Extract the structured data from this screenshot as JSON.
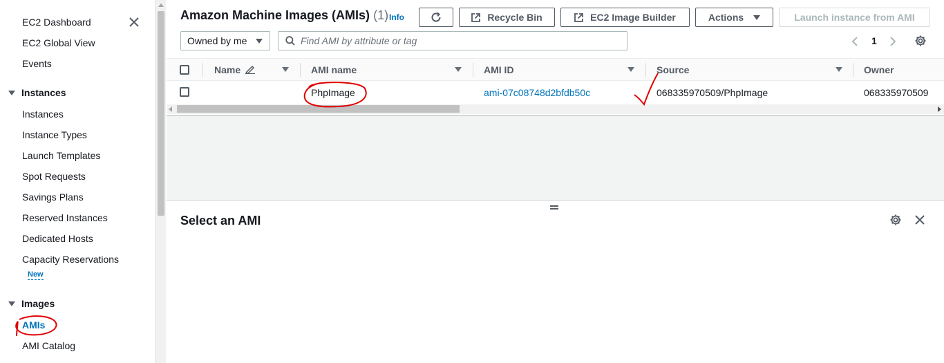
{
  "sidebar": {
    "top_items": [
      {
        "label": "EC2 Dashboard"
      },
      {
        "label": "EC2 Global View"
      },
      {
        "label": "Events"
      }
    ],
    "instances_section": {
      "label": "Instances",
      "items": [
        {
          "label": "Instances"
        },
        {
          "label": "Instance Types"
        },
        {
          "label": "Launch Templates"
        },
        {
          "label": "Spot Requests"
        },
        {
          "label": "Savings Plans"
        },
        {
          "label": "Reserved Instances"
        },
        {
          "label": "Dedicated Hosts"
        },
        {
          "label": "Capacity Reservations"
        }
      ],
      "new_badge": "New"
    },
    "images_section": {
      "label": "Images",
      "items": [
        {
          "label": "AMIs"
        },
        {
          "label": "AMI Catalog"
        }
      ]
    }
  },
  "header": {
    "title": "Amazon Machine Images (AMIs)",
    "count": "(1)",
    "info_link": "Info",
    "buttons": {
      "recycle_bin": "Recycle Bin",
      "image_builder": "EC2 Image Builder",
      "actions": "Actions",
      "launch": "Launch instance from AMI"
    }
  },
  "filter": {
    "owner_select": "Owned by me",
    "search_placeholder": "Find AMI by attribute or tag"
  },
  "pagination": {
    "current_page": "1"
  },
  "table": {
    "columns": [
      "Name",
      "AMI name",
      "AMI ID",
      "Source",
      "Owner"
    ],
    "rows": [
      {
        "name": "",
        "ami_name": "PhpImage",
        "ami_id": "ami-07c08748d2bfdb50c",
        "source": "068335970509/PhpImage",
        "owner": "068335970509"
      }
    ]
  },
  "split_panel": {
    "title": "Select an AMI"
  },
  "colors": {
    "link": "#0073bb",
    "annotation": "#e00000",
    "text": "#16191f",
    "muted": "#545b64"
  }
}
